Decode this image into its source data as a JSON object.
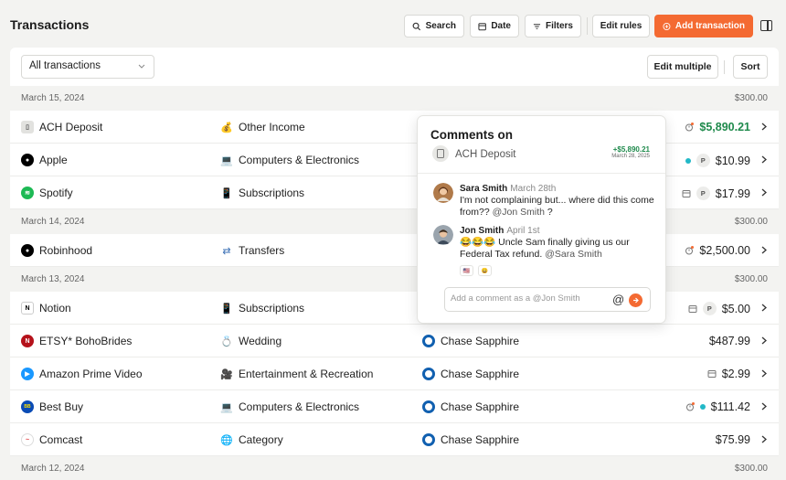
{
  "header": {
    "title": "Transactions",
    "search_label": "Search",
    "date_label": "Date",
    "filters_label": "Filters",
    "edit_rules_label": "Edit rules",
    "add_label": "Add transaction",
    "accent": "#f46a32"
  },
  "toolbar": {
    "filter_value": "All transactions",
    "edit_multiple_label": "Edit multiple",
    "sort_label": "Sort"
  },
  "groups": [
    {
      "date": "March 15, 2024",
      "total": "$300.00",
      "rows": [
        {
          "merchant": "ACH Deposit",
          "category": "Other Income",
          "account": "",
          "amount": "$5,890.21"
        },
        {
          "merchant": "Apple",
          "category": "Computers & Electronics",
          "account": "",
          "amount": "$10.99",
          "badge": "P"
        },
        {
          "merchant": "Spotify",
          "category": "Subscriptions",
          "account": "",
          "amount": "$17.99",
          "badge": "P"
        }
      ]
    },
    {
      "date": "March 14, 2024",
      "total": "$300.00",
      "rows": [
        {
          "merchant": "Robinhood",
          "category": "Transfers",
          "account": "",
          "amount": "$2,500.00"
        }
      ]
    },
    {
      "date": "March 13, 2024",
      "total": "$300.00",
      "rows": [
        {
          "merchant": "Notion",
          "category": "Subscriptions",
          "account": "",
          "amount": "$5.00",
          "badge": "P"
        },
        {
          "merchant": "ETSY* BohoBrides",
          "category": "Wedding",
          "account": "Chase Sapphire",
          "amount": "$487.99"
        },
        {
          "merchant": "Amazon Prime Video",
          "category": "Entertainment & Recreation",
          "account": "Chase Sapphire",
          "amount": "$2.99"
        },
        {
          "merchant": "Best Buy",
          "category": "Computers & Electronics",
          "account": "Chase Sapphire",
          "amount": "$111.42"
        },
        {
          "merchant": "Comcast",
          "category": "Category",
          "account": "Chase Sapphire",
          "amount": "$75.99"
        }
      ]
    },
    {
      "date": "March 12, 2024",
      "total": "$300.00",
      "rows": []
    }
  ],
  "popover": {
    "title": "Comments on",
    "account": "ACH Deposit",
    "amount": "+$5,890.21",
    "date": "March 28, 2025",
    "comments": [
      {
        "name": "Sara Smith",
        "date": "March 28th",
        "text": "I'm not complaining but... where did this come from?? ",
        "mention": "@Jon Smith",
        "suffix": " ?"
      },
      {
        "name": "Jon Smith",
        "date": "April 1st",
        "text": "😂😂😂 Uncle Sam finally giving us our Federal Tax refund. ",
        "mention": "@Sara Smith",
        "suffix": ""
      }
    ],
    "input_placeholder": "Add a comment as a @Jon Smith",
    "at_symbol": "@"
  }
}
